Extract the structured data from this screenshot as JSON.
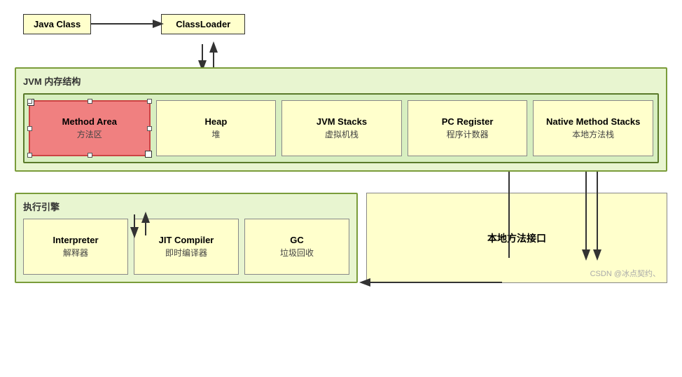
{
  "top": {
    "java_class_label": "Java Class",
    "classloader_label": "ClassLoader"
  },
  "jvm": {
    "title": "JVM 内存结构",
    "cells": [
      {
        "id": "method-area",
        "title": "Method Area",
        "subtitle": "方法区",
        "style": "red"
      },
      {
        "id": "heap",
        "title": "Heap",
        "subtitle": "堆",
        "style": "yellow"
      },
      {
        "id": "jvm-stacks",
        "title": "JVM Stacks",
        "subtitle": "虚拟机栈",
        "style": "yellow"
      },
      {
        "id": "pc-register",
        "title": "PC Register",
        "subtitle": "程序计数器",
        "style": "yellow"
      },
      {
        "id": "native-method-stacks",
        "title": "Native Method Stacks",
        "subtitle": "本地方法栈",
        "style": "yellow"
      }
    ]
  },
  "execution": {
    "title": "执行引擎",
    "cells": [
      {
        "id": "interpreter",
        "title": "Interpreter",
        "subtitle": "解释器"
      },
      {
        "id": "jit-compiler",
        "title": "JIT Compiler",
        "subtitle": "即时编译器"
      },
      {
        "id": "gc",
        "title": "GC",
        "subtitle": "垃圾回收"
      }
    ]
  },
  "native_interface": {
    "label": "本地方法接口"
  },
  "watermark": "CSDN @冰点契约、"
}
